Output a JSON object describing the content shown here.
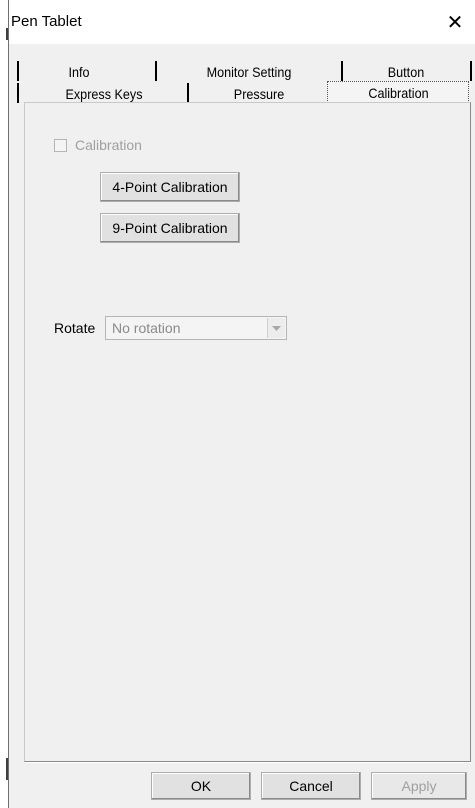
{
  "window": {
    "title": "Pen Tablet",
    "close_glyph": "✕"
  },
  "tabs": {
    "row1": [
      {
        "label": "Info"
      },
      {
        "label": "Monitor Setting"
      },
      {
        "label": "Button"
      }
    ],
    "row2": [
      {
        "label": "Express Keys"
      },
      {
        "label": "Pressure"
      },
      {
        "label": "Calibration",
        "active": true
      }
    ]
  },
  "calibration": {
    "checkbox_label": "Calibration",
    "checkbox_checked": false,
    "four_point_label": "4-Point Calibration",
    "nine_point_label": "9-Point Calibration"
  },
  "rotate": {
    "label": "Rotate",
    "selected_value": "No rotation"
  },
  "footer": {
    "ok_label": "OK",
    "cancel_label": "Cancel",
    "apply_label": "Apply",
    "apply_disabled": true
  },
  "colors": {
    "window_bg": "#f0f0f0",
    "disabled_text": "#a0a0a0"
  }
}
